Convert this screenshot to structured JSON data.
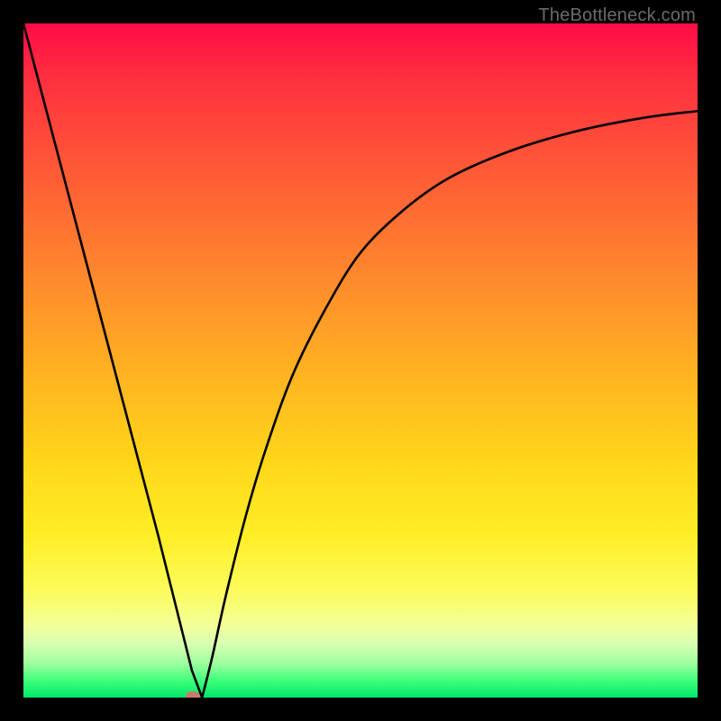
{
  "watermark": "TheBottleneck.com",
  "chart_data": {
    "type": "line",
    "title": "",
    "xlabel": "",
    "ylabel": "",
    "xlim": [
      0,
      100
    ],
    "ylim": [
      0,
      100
    ],
    "grid": false,
    "legend": false,
    "series": [
      {
        "name": "left-segment",
        "x": [
          0,
          5,
          10,
          15,
          20,
          23,
          25,
          26.5
        ],
        "y": [
          100,
          81,
          62,
          43,
          24,
          12,
          4,
          0
        ]
      },
      {
        "name": "right-curve",
        "x": [
          26.5,
          28,
          30,
          33,
          36,
          40,
          45,
          50,
          56,
          63,
          72,
          82,
          92,
          100
        ],
        "y": [
          0,
          6,
          15,
          27,
          37,
          48,
          58,
          66,
          72,
          77,
          81,
          84,
          86,
          87
        ]
      }
    ],
    "markers": [
      {
        "name": "min-marker",
        "x": 25.2,
        "y": 0.2,
        "shape": "oval",
        "color": "#e46a6a"
      }
    ],
    "background": {
      "type": "vertical-gradient",
      "stops": [
        {
          "pos": 0.0,
          "color": "#ff0b46"
        },
        {
          "pos": 0.22,
          "color": "#ff5a36"
        },
        {
          "pos": 0.52,
          "color": "#ffb321"
        },
        {
          "pos": 0.76,
          "color": "#ffee26"
        },
        {
          "pos": 0.92,
          "color": "#d9ffb3"
        },
        {
          "pos": 1.0,
          "color": "#00e86a"
        }
      ]
    }
  }
}
